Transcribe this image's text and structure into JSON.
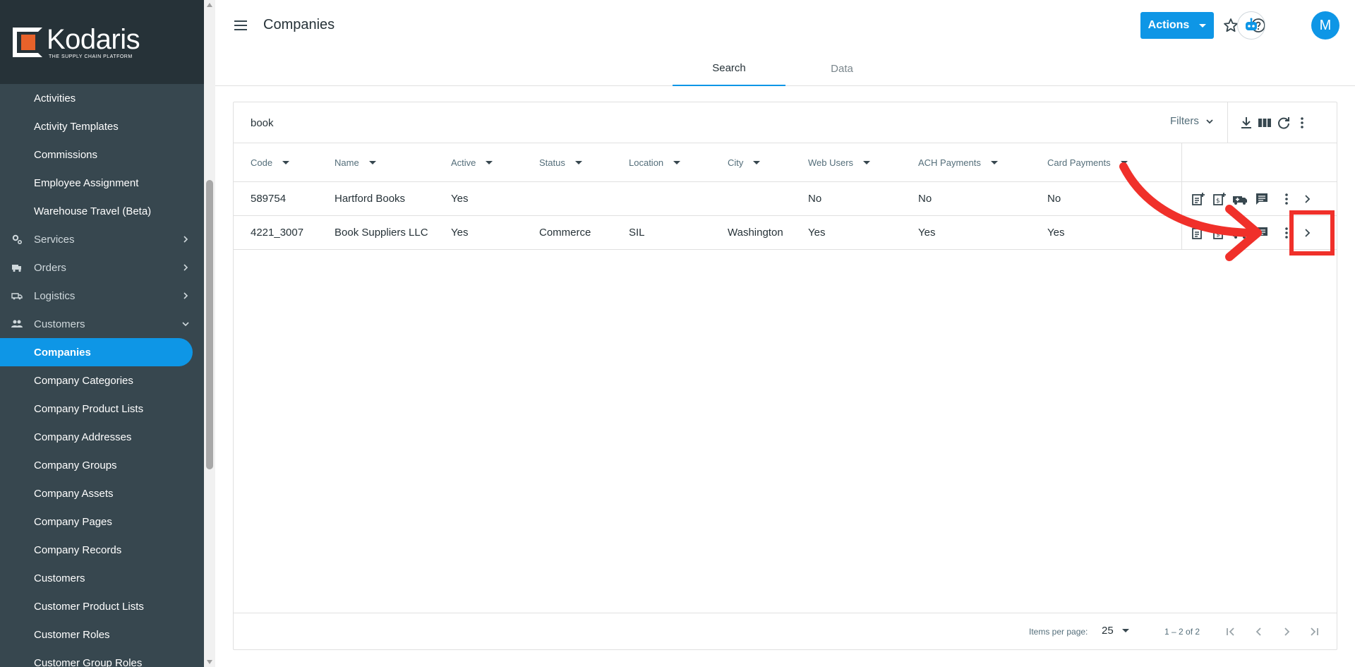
{
  "sidebar": {
    "brand": "Kodaris",
    "tagline": "THE SUPPLY CHAIN PLATFORM",
    "items": [
      {
        "label": "Activities"
      },
      {
        "label": "Activity Templates"
      },
      {
        "label": "Commissions"
      },
      {
        "label": "Employee Assignment"
      },
      {
        "label": "Warehouse Travel (Beta)"
      },
      {
        "label": "Services",
        "icon": "gears-icon"
      },
      {
        "label": "Orders",
        "icon": "truck-icon"
      },
      {
        "label": "Logistics",
        "icon": "shipping-icon"
      },
      {
        "label": "Customers",
        "icon": "people-icon"
      },
      {
        "label": "Companies"
      },
      {
        "label": "Company Categories"
      },
      {
        "label": "Company Product Lists"
      },
      {
        "label": "Company Addresses"
      },
      {
        "label": "Company Groups"
      },
      {
        "label": "Company Assets"
      },
      {
        "label": "Company Pages"
      },
      {
        "label": "Company Records"
      },
      {
        "label": "Customers"
      },
      {
        "label": "Customer Product Lists"
      },
      {
        "label": "Customer Roles"
      },
      {
        "label": "Customer Group Roles"
      }
    ]
  },
  "header": {
    "title": "Companies",
    "actions_label": "Actions",
    "avatar_initial": "M"
  },
  "tabs": [
    {
      "label": "Search"
    },
    {
      "label": "Data"
    }
  ],
  "search": {
    "value": "book",
    "filters_label": "Filters"
  },
  "table": {
    "columns": [
      "Code",
      "Name",
      "Active",
      "Status",
      "Location",
      "City",
      "Web Users",
      "ACH Payments",
      "Card Payments"
    ],
    "rows": [
      [
        "589754",
        "Hartford Books",
        "Yes",
        "",
        "",
        "",
        "No",
        "No",
        "No"
      ],
      [
        "4221_3007",
        "Book Suppliers LLC",
        "Yes",
        "Commerce",
        "SIL",
        "Washington",
        "Yes",
        "Yes",
        "Yes"
      ]
    ]
  },
  "paginator": {
    "items_per_page_label": "Items per page:",
    "items_per_page": "25",
    "range": "1 – 2 of 2"
  },
  "colors": {
    "accent": "#0e96e6",
    "sidebar_bg": "#37474f",
    "annotation": "#f0302a"
  }
}
